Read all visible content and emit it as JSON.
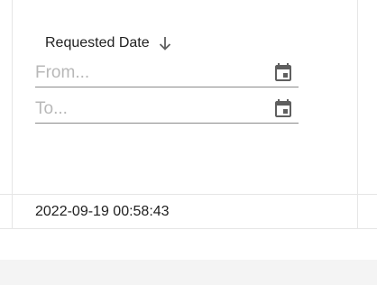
{
  "column_header": {
    "title": "Requested Date",
    "sort_icon": "arrow-down-icon"
  },
  "filters": {
    "from": {
      "placeholder": "From...",
      "value": "",
      "icon": "calendar-icon"
    },
    "to": {
      "placeholder": "To...",
      "value": "",
      "icon": "calendar-icon"
    }
  },
  "rows": [
    {
      "requested_date": "2022-09-19 00:58:43"
    }
  ],
  "colors": {
    "icon": "#5f5f5f",
    "text": "#212121",
    "placeholder": "#b8b8b8",
    "grid_line": "#e6e6e6"
  }
}
